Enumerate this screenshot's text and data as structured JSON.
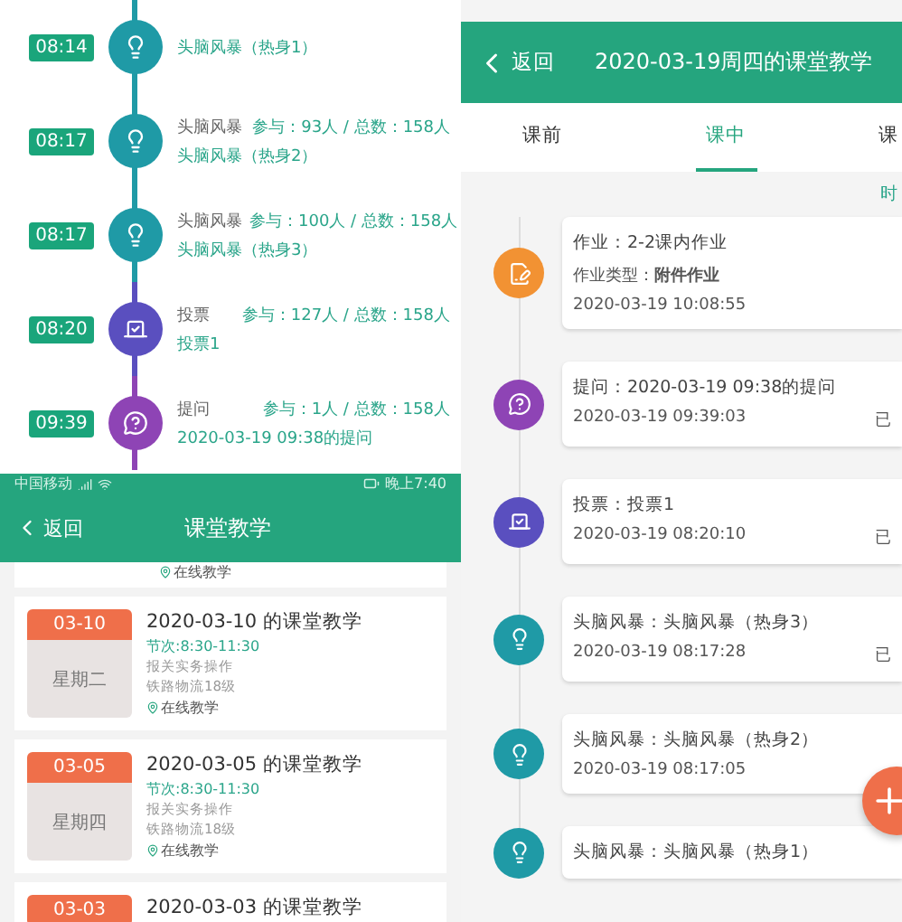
{
  "activity_timeline": [
    {
      "kind": "brainstorm",
      "time": "08:14",
      "title": "头脑风暴（热身1）"
    },
    {
      "kind": "brainstorm",
      "time": "08:17",
      "type": "头脑风暴",
      "stats": "参与：93人 / 总数：158人",
      "title": "头脑风暴（热身2）"
    },
    {
      "kind": "brainstorm",
      "time": "08:17",
      "type": "头脑风暴",
      "stats": "参与：100人 / 总数：158人",
      "title": "头脑风暴（热身3）"
    },
    {
      "kind": "vote",
      "time": "08:20",
      "type": "投票",
      "stats": "参与：127人 / 总数：158人",
      "title": "投票1"
    },
    {
      "kind": "question",
      "time": "09:39",
      "type": "提问",
      "stats": "参与：1人 / 总数：158人",
      "title": "2020-03-19 09:38的提问"
    }
  ],
  "class_list_screen": {
    "status_bar": {
      "carrier": "中国移动",
      "time": "晚上7:40"
    },
    "header": {
      "back": "返回",
      "title": "课堂教学"
    },
    "partial_card": {
      "location": "在线教学"
    },
    "cards": [
      {
        "date": "03-10",
        "weekday": "星期二",
        "title": "2020-03-10 的课堂教学",
        "period": "节次:8:30-11:30",
        "course": "报关实务操作",
        "class": "铁路物流18级",
        "location": "在线教学"
      },
      {
        "date": "03-05",
        "weekday": "星期四",
        "title": "2020-03-05 的课堂教学",
        "period": "节次:8:30-11:30",
        "course": "报关实务操作",
        "class": "铁路物流18级",
        "location": "在线教学"
      },
      {
        "date": "03-03",
        "title": "2020-03-03 的课堂教学"
      }
    ]
  },
  "lesson_screen": {
    "header": {
      "back": "返回",
      "title": "2020-03-19周四的课堂教学"
    },
    "tabs": [
      {
        "label": "课前",
        "selected": false
      },
      {
        "label": "课中",
        "selected": true
      },
      {
        "label": "课",
        "selected": false
      }
    ],
    "sort_label": "时",
    "items": [
      {
        "kind": "homework",
        "title": "作业：2-2课内作业",
        "detail": "作业类型：**附件作业**",
        "datetime": "2020-03-19 10:08:55"
      },
      {
        "kind": "question",
        "title": "提问：2020-03-19 09:38的提问",
        "datetime": "2020-03-19 09:39:03",
        "status": "已"
      },
      {
        "kind": "vote",
        "title": "投票：投票1",
        "datetime": "2020-03-19 08:20:10",
        "status": "已"
      },
      {
        "kind": "brainstorm",
        "title": "头脑风暴：头脑风暴（热身3）",
        "datetime": "2020-03-19 08:17:28",
        "status": "已"
      },
      {
        "kind": "brainstorm",
        "title": "头脑风暴：头脑风暴（热身2）",
        "datetime": "2020-03-19 08:17:05"
      },
      {
        "kind": "brainstorm",
        "title": "头脑风暴：头脑风暴（热身1）"
      }
    ]
  }
}
